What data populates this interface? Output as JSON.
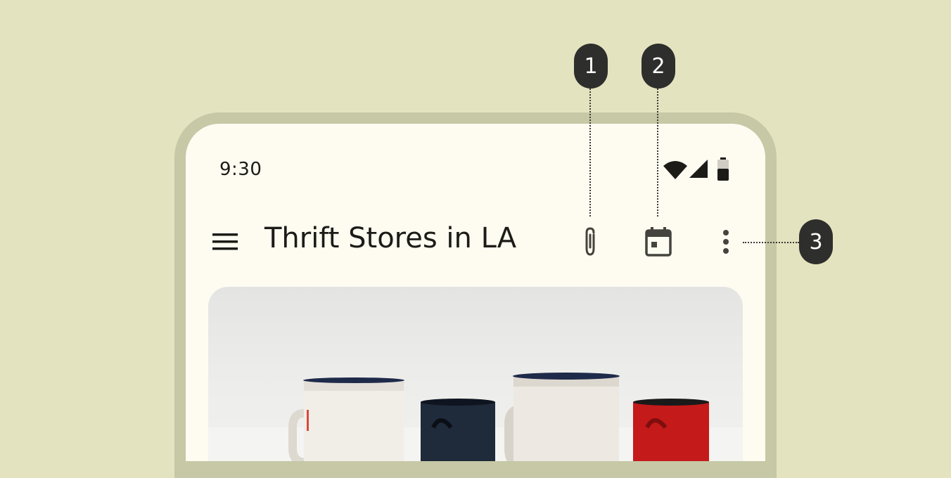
{
  "status_bar": {
    "time": "9:30",
    "icons": [
      "wifi-icon",
      "cell-signal-icon",
      "battery-icon"
    ]
  },
  "top_app_bar": {
    "navigation_icon": "menu-icon",
    "title": "Thrift Stores in LA",
    "actions": [
      {
        "icon": "attach-file-icon"
      },
      {
        "icon": "calendar-icon"
      },
      {
        "icon": "more-vert-icon"
      }
    ]
  },
  "hero_image": {
    "subject": "enamel mugs",
    "mug_colors": [
      "#f1eee8",
      "#1f2a3a",
      "#ede9e2",
      "#c41a1a"
    ]
  },
  "callouts": [
    {
      "label": "1"
    },
    {
      "label": "2"
    },
    {
      "label": "3"
    }
  ],
  "colors": {
    "background": "#e4e3c0",
    "device_frame": "#c6c8a6",
    "screen": "#fefbf1",
    "badge": "#2e2e2c"
  }
}
